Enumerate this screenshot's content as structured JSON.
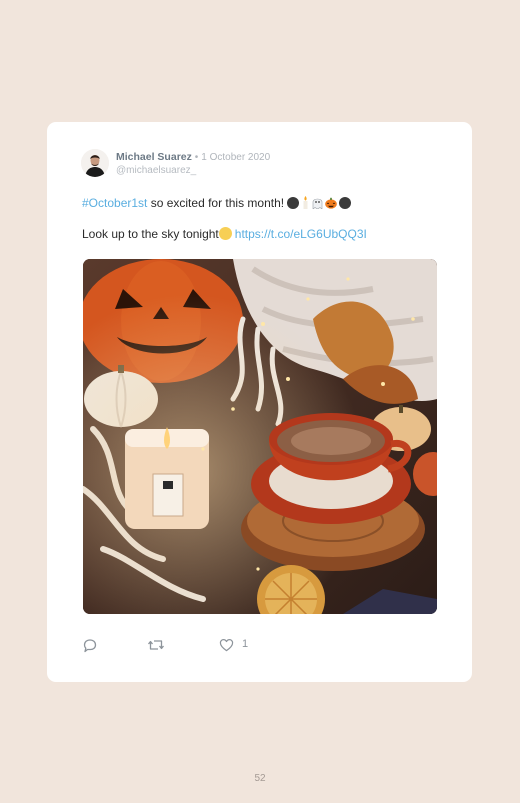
{
  "post": {
    "author_name": "Michael Suarez",
    "separator": "•",
    "date": "1 October 2020",
    "handle": "@michaelsuarez_",
    "line1": {
      "hashtag": "#October1st",
      "text": " so excited for this month! "
    },
    "line2": {
      "text": "Look up to the sky tonight",
      "link": "https://t.co/eLG6UbQQ3I"
    },
    "emojis_line1": [
      "new-moon",
      "candle",
      "ghost",
      "jack-o-lantern",
      "new-moon"
    ],
    "emoji_line2": "full-moon",
    "likes_count": "1"
  },
  "actions": [
    "reply",
    "retweet",
    "like"
  ],
  "page": {
    "number": "52"
  },
  "colors": {
    "background": "#f1e5dc",
    "card": "#ffffff",
    "link": "#5aaee0",
    "author": "#6d7a86",
    "muted": "#b0b5bb",
    "icon": "#8d949b"
  }
}
